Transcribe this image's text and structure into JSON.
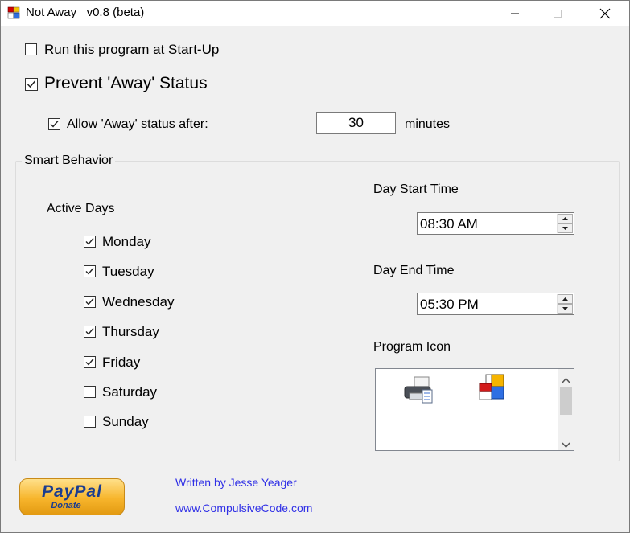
{
  "window": {
    "title": "Not Away   v0.8 (beta)",
    "icons": [
      "app-icon",
      "minimize-icon",
      "maximize-icon",
      "close-icon"
    ]
  },
  "startup": {
    "label": "Run this program at Start-Up",
    "checked": false
  },
  "prevent_away": {
    "label": "Prevent 'Away' Status",
    "checked": true
  },
  "allow_away": {
    "label": "Allow 'Away' status after:",
    "checked": true,
    "value": "30",
    "unit": "minutes"
  },
  "smart": {
    "title": "Smart Behavior",
    "active_days_label": "Active Days",
    "days": [
      {
        "label": "Monday",
        "checked": true
      },
      {
        "label": "Tuesday",
        "checked": true
      },
      {
        "label": "Wednesday",
        "checked": true
      },
      {
        "label": "Thursday",
        "checked": true
      },
      {
        "label": "Friday",
        "checked": true
      },
      {
        "label": "Saturday",
        "checked": false
      },
      {
        "label": "Sunday",
        "checked": false
      }
    ],
    "start_label": "Day Start Time",
    "start_value": "08:30 AM",
    "end_label": "Day End Time",
    "end_value": "05:30 PM",
    "icon_label": "Program Icon",
    "icon_options": [
      "printer-icon",
      "color-squares-icon"
    ]
  },
  "footer": {
    "paypal_title": "PayPal",
    "paypal_sub": "Donate",
    "author": "Written by Jesse Yeager",
    "website": "www.CompulsiveCode.com"
  },
  "colors": {
    "link": "#3030e6",
    "paypal_gold": "#f7b52c",
    "paypal_blue": "#1b3d8f"
  }
}
